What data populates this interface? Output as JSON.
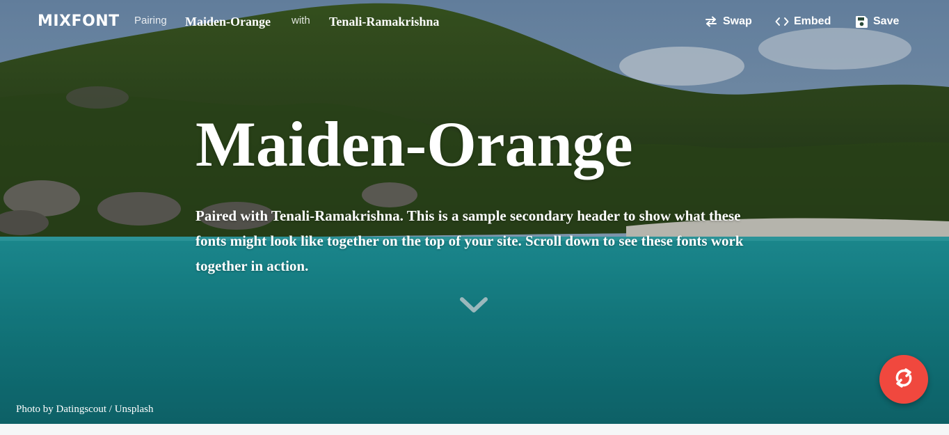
{
  "header": {
    "logo": "MIXFONT",
    "pairing_label": "Pairing",
    "primary_font": "Maiden-Orange",
    "with_label": "with",
    "secondary_font": "Tenali-Ramakrishna",
    "actions": {
      "swap": "Swap",
      "embed": "Embed",
      "save": "Save"
    }
  },
  "hero": {
    "headline": "Maiden-Orange",
    "subheadline": "Paired with Tenali-Ramakrishna. This is a sample secondary header to show what these fonts might look like together on the top of your site. Scroll down to see these fonts work together in action."
  },
  "credit": {
    "prefix": "Photo by",
    "photographer": "Datingscout",
    "separator": "/",
    "source": "Unsplash"
  },
  "icons": {
    "swap": "swap-arrows-icon",
    "embed": "code-icon",
    "save": "floppy-disk-icon",
    "scroll": "chevron-down-icon",
    "shuffle": "refresh-icon"
  },
  "colors": {
    "fab": "#f0483e",
    "text": "#ffffff"
  }
}
